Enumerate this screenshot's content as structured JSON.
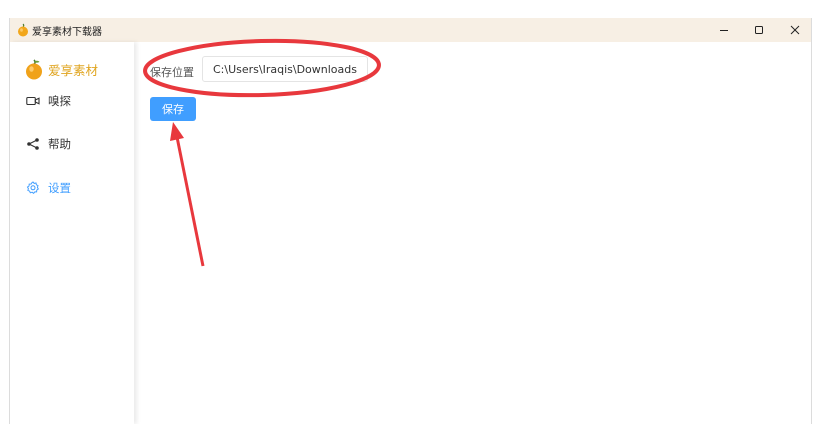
{
  "window": {
    "title": "爱享素材下载器",
    "controls": {
      "minimize_icon": "minimize-icon",
      "maximize_icon": "maximize-icon",
      "close_icon": "close-icon"
    }
  },
  "sidebar": {
    "brand": "爱享素材",
    "items": [
      {
        "label": "嗅探",
        "icon": "video-camera-icon",
        "active": false
      },
      {
        "label": "帮助",
        "icon": "share-icon",
        "active": false
      },
      {
        "label": "设置",
        "icon": "gear-icon",
        "active": true
      }
    ]
  },
  "settings": {
    "path_label": "保存位置",
    "path_value": "C:\\Users\\Iraqis\\Downloads",
    "save_button": "保存"
  },
  "colors": {
    "accent": "#409eff",
    "brand": "#e0a521",
    "titlebar_bg": "#f7efe4",
    "annotation_red": "#e8383d"
  }
}
